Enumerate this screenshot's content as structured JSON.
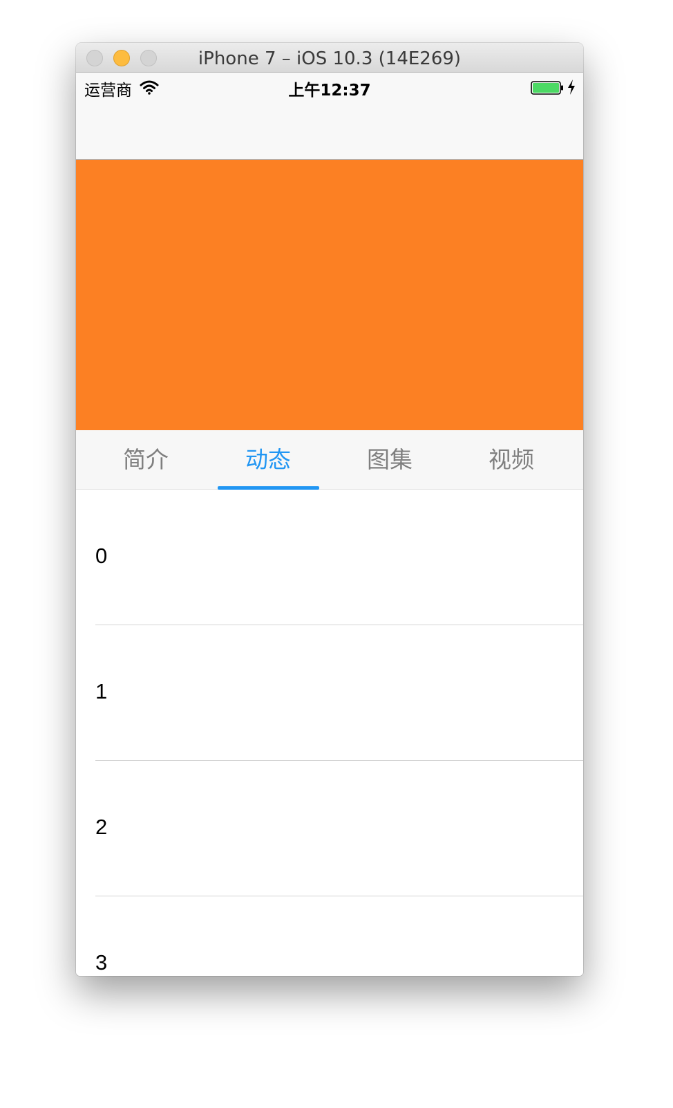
{
  "window": {
    "title": "iPhone 7 – iOS 10.3 (14E269)"
  },
  "status_bar": {
    "carrier": "运营商",
    "time": "上午12:37",
    "wifi_icon": "wifi-icon",
    "battery_icon": "battery-full-icon",
    "charging_icon": "bolt-icon"
  },
  "header": {
    "banner_color": "#fc8023"
  },
  "tabs": {
    "items": [
      {
        "label": "简介",
        "selected": false
      },
      {
        "label": "动态",
        "selected": true
      },
      {
        "label": "图集",
        "selected": false
      },
      {
        "label": "视频",
        "selected": false
      }
    ],
    "active_color": "#2196f3",
    "inactive_color": "#7f7f7f"
  },
  "list": {
    "rows": [
      "0",
      "1",
      "2",
      "3"
    ]
  }
}
